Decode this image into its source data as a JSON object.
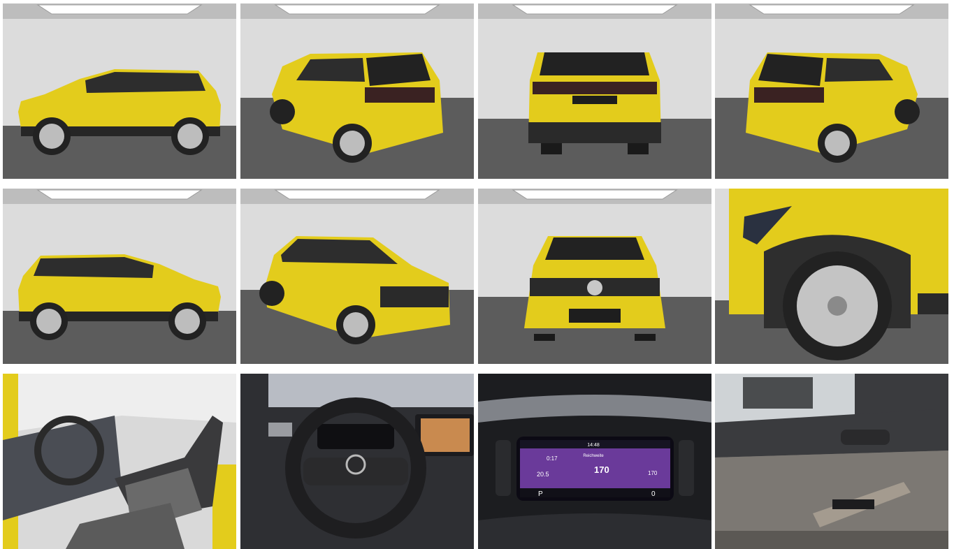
{
  "gallery": {
    "layout": "grid 4x3",
    "images": [
      {
        "view": "side-left",
        "subject": "car-exterior"
      },
      {
        "view": "rear-left-three-quarter",
        "subject": "car-exterior"
      },
      {
        "view": "rear",
        "subject": "car-exterior"
      },
      {
        "view": "rear-right-three-quarter",
        "subject": "car-exterior"
      },
      {
        "view": "side-right",
        "subject": "car-exterior"
      },
      {
        "view": "front-left-three-quarter",
        "subject": "car-exterior"
      },
      {
        "view": "front",
        "subject": "car-exterior"
      },
      {
        "view": "front-wheel-detail",
        "subject": "car-exterior"
      },
      {
        "view": "front-seats",
        "subject": "car-interior"
      },
      {
        "view": "steering-wheel",
        "subject": "car-interior"
      },
      {
        "view": "instrument-cluster",
        "subject": "car-interior"
      },
      {
        "view": "door-panel",
        "subject": "car-interior"
      }
    ],
    "colors": {
      "body": "#e3cc1c",
      "studio_wall": "#dcdcdc",
      "studio_floor": "#5c5c5c",
      "interior_dark": "#3a3a3c",
      "display_accent": "#9b57c8"
    }
  },
  "cluster": {
    "time": "14:48",
    "range_label": "Reichweite",
    "range_main": "170",
    "range_right": "170",
    "trip_avg": "0:17",
    "consumption": "20.5",
    "gear": "P",
    "speed": "0"
  }
}
